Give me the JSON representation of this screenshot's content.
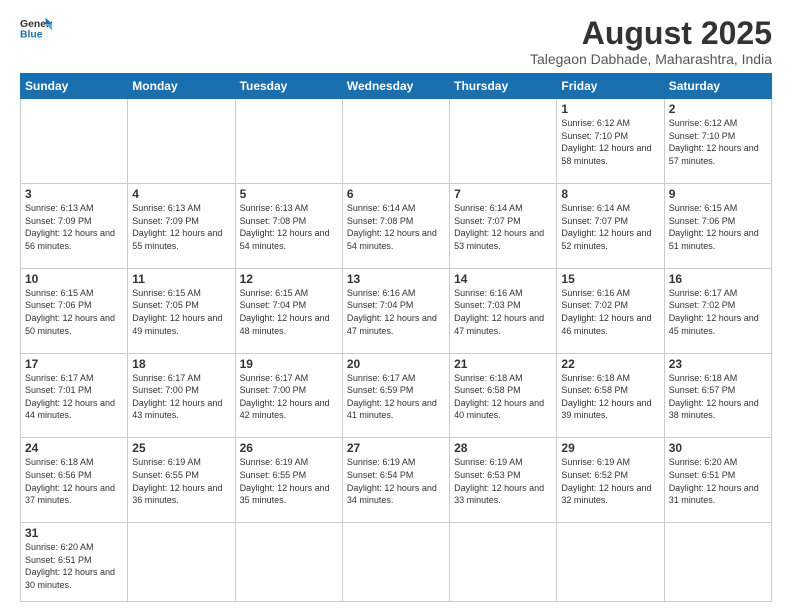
{
  "header": {
    "logo_general": "General",
    "logo_blue": "Blue",
    "title": "August 2025",
    "subtitle": "Talegaon Dabhade, Maharashtra, India"
  },
  "weekdays": [
    "Sunday",
    "Monday",
    "Tuesday",
    "Wednesday",
    "Thursday",
    "Friday",
    "Saturday"
  ],
  "weeks": [
    [
      {
        "day": "",
        "info": ""
      },
      {
        "day": "",
        "info": ""
      },
      {
        "day": "",
        "info": ""
      },
      {
        "day": "",
        "info": ""
      },
      {
        "day": "",
        "info": ""
      },
      {
        "day": "1",
        "info": "Sunrise: 6:12 AM\nSunset: 7:10 PM\nDaylight: 12 hours and 58 minutes."
      },
      {
        "day": "2",
        "info": "Sunrise: 6:12 AM\nSunset: 7:10 PM\nDaylight: 12 hours and 57 minutes."
      }
    ],
    [
      {
        "day": "3",
        "info": "Sunrise: 6:13 AM\nSunset: 7:09 PM\nDaylight: 12 hours and 56 minutes."
      },
      {
        "day": "4",
        "info": "Sunrise: 6:13 AM\nSunset: 7:09 PM\nDaylight: 12 hours and 55 minutes."
      },
      {
        "day": "5",
        "info": "Sunrise: 6:13 AM\nSunset: 7:08 PM\nDaylight: 12 hours and 54 minutes."
      },
      {
        "day": "6",
        "info": "Sunrise: 6:14 AM\nSunset: 7:08 PM\nDaylight: 12 hours and 54 minutes."
      },
      {
        "day": "7",
        "info": "Sunrise: 6:14 AM\nSunset: 7:07 PM\nDaylight: 12 hours and 53 minutes."
      },
      {
        "day": "8",
        "info": "Sunrise: 6:14 AM\nSunset: 7:07 PM\nDaylight: 12 hours and 52 minutes."
      },
      {
        "day": "9",
        "info": "Sunrise: 6:15 AM\nSunset: 7:06 PM\nDaylight: 12 hours and 51 minutes."
      }
    ],
    [
      {
        "day": "10",
        "info": "Sunrise: 6:15 AM\nSunset: 7:06 PM\nDaylight: 12 hours and 50 minutes."
      },
      {
        "day": "11",
        "info": "Sunrise: 6:15 AM\nSunset: 7:05 PM\nDaylight: 12 hours and 49 minutes."
      },
      {
        "day": "12",
        "info": "Sunrise: 6:15 AM\nSunset: 7:04 PM\nDaylight: 12 hours and 48 minutes."
      },
      {
        "day": "13",
        "info": "Sunrise: 6:16 AM\nSunset: 7:04 PM\nDaylight: 12 hours and 47 minutes."
      },
      {
        "day": "14",
        "info": "Sunrise: 6:16 AM\nSunset: 7:03 PM\nDaylight: 12 hours and 47 minutes."
      },
      {
        "day": "15",
        "info": "Sunrise: 6:16 AM\nSunset: 7:02 PM\nDaylight: 12 hours and 46 minutes."
      },
      {
        "day": "16",
        "info": "Sunrise: 6:17 AM\nSunset: 7:02 PM\nDaylight: 12 hours and 45 minutes."
      }
    ],
    [
      {
        "day": "17",
        "info": "Sunrise: 6:17 AM\nSunset: 7:01 PM\nDaylight: 12 hours and 44 minutes."
      },
      {
        "day": "18",
        "info": "Sunrise: 6:17 AM\nSunset: 7:00 PM\nDaylight: 12 hours and 43 minutes."
      },
      {
        "day": "19",
        "info": "Sunrise: 6:17 AM\nSunset: 7:00 PM\nDaylight: 12 hours and 42 minutes."
      },
      {
        "day": "20",
        "info": "Sunrise: 6:17 AM\nSunset: 6:59 PM\nDaylight: 12 hours and 41 minutes."
      },
      {
        "day": "21",
        "info": "Sunrise: 6:18 AM\nSunset: 6:58 PM\nDaylight: 12 hours and 40 minutes."
      },
      {
        "day": "22",
        "info": "Sunrise: 6:18 AM\nSunset: 6:58 PM\nDaylight: 12 hours and 39 minutes."
      },
      {
        "day": "23",
        "info": "Sunrise: 6:18 AM\nSunset: 6:57 PM\nDaylight: 12 hours and 38 minutes."
      }
    ],
    [
      {
        "day": "24",
        "info": "Sunrise: 6:18 AM\nSunset: 6:56 PM\nDaylight: 12 hours and 37 minutes."
      },
      {
        "day": "25",
        "info": "Sunrise: 6:19 AM\nSunset: 6:55 PM\nDaylight: 12 hours and 36 minutes."
      },
      {
        "day": "26",
        "info": "Sunrise: 6:19 AM\nSunset: 6:55 PM\nDaylight: 12 hours and 35 minutes."
      },
      {
        "day": "27",
        "info": "Sunrise: 6:19 AM\nSunset: 6:54 PM\nDaylight: 12 hours and 34 minutes."
      },
      {
        "day": "28",
        "info": "Sunrise: 6:19 AM\nSunset: 6:53 PM\nDaylight: 12 hours and 33 minutes."
      },
      {
        "day": "29",
        "info": "Sunrise: 6:19 AM\nSunset: 6:52 PM\nDaylight: 12 hours and 32 minutes."
      },
      {
        "day": "30",
        "info": "Sunrise: 6:20 AM\nSunset: 6:51 PM\nDaylight: 12 hours and 31 minutes."
      }
    ],
    [
      {
        "day": "31",
        "info": "Sunrise: 6:20 AM\nSunset: 6:51 PM\nDaylight: 12 hours and 30 minutes."
      },
      {
        "day": "",
        "info": ""
      },
      {
        "day": "",
        "info": ""
      },
      {
        "day": "",
        "info": ""
      },
      {
        "day": "",
        "info": ""
      },
      {
        "day": "",
        "info": ""
      },
      {
        "day": "",
        "info": ""
      }
    ]
  ]
}
